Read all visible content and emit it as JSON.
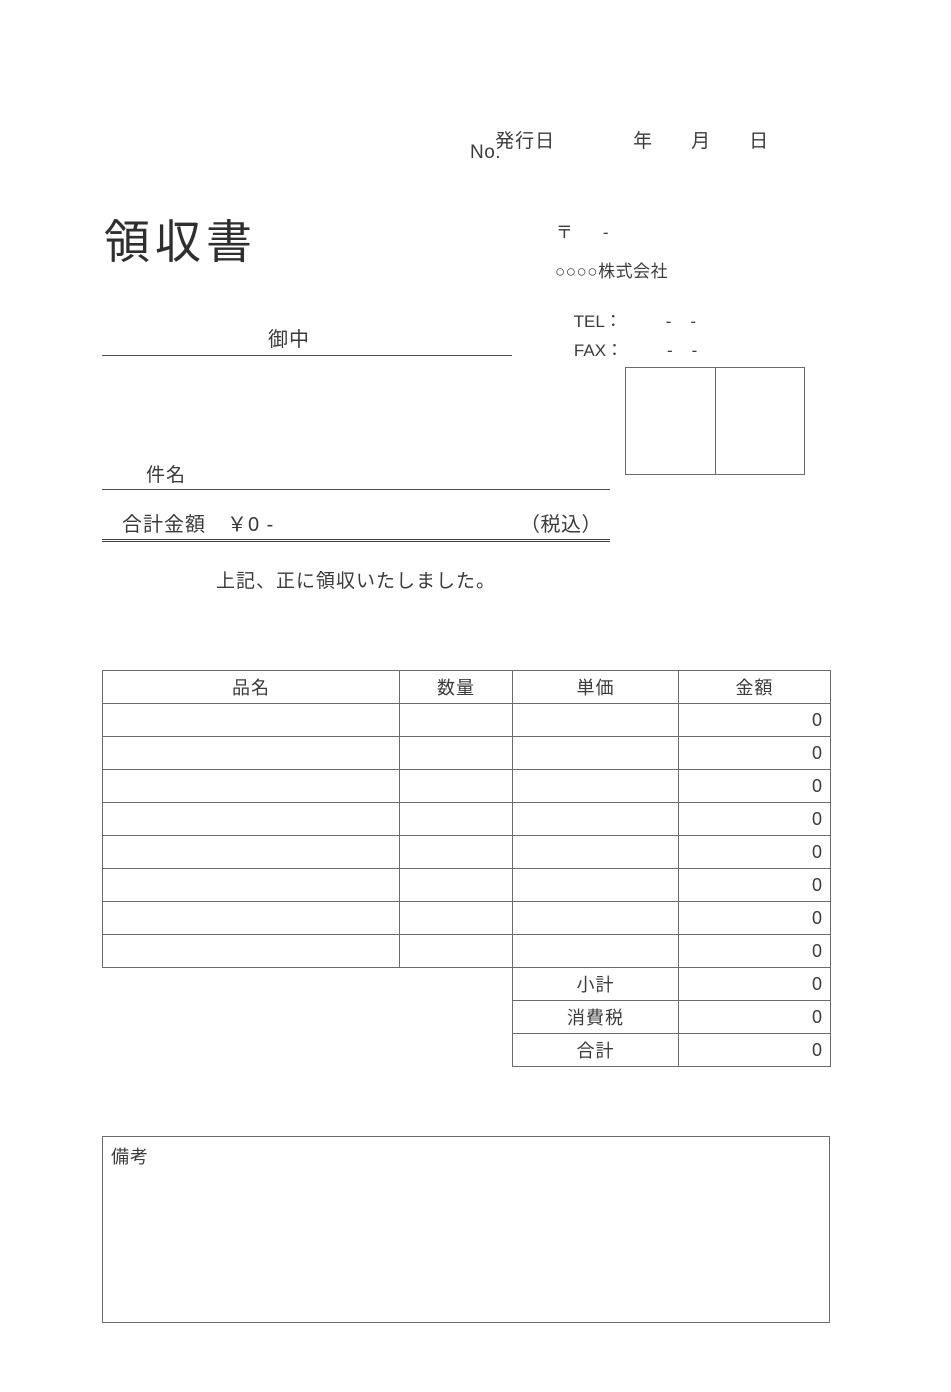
{
  "document": {
    "title": "領収書",
    "addressee_label": "御中",
    "subject_label": "件名",
    "receipt_note": "上記、正に領収いたしました。"
  },
  "header": {
    "issue_date_label": "発行日",
    "year_label": "年",
    "month_label": "月",
    "day_label": "日",
    "number_label": "No."
  },
  "issuer": {
    "postal_mark": "〒",
    "postal_separator": "-",
    "company_name": "○○○○株式会社",
    "tel_label": "TEL：",
    "tel_value": "-    -",
    "fax_label": "FAX：",
    "fax_value": "-    -"
  },
  "total": {
    "label": "合計金額",
    "amount": "￥0 -",
    "tax_note": "（税込）"
  },
  "items": {
    "headers": [
      "品名",
      "数量",
      "単価",
      "金額"
    ],
    "rows": [
      {
        "name": "",
        "qty": "",
        "price": "",
        "amount": "0"
      },
      {
        "name": "",
        "qty": "",
        "price": "",
        "amount": "0"
      },
      {
        "name": "",
        "qty": "",
        "price": "",
        "amount": "0"
      },
      {
        "name": "",
        "qty": "",
        "price": "",
        "amount": "0"
      },
      {
        "name": "",
        "qty": "",
        "price": "",
        "amount": "0"
      },
      {
        "name": "",
        "qty": "",
        "price": "",
        "amount": "0"
      },
      {
        "name": "",
        "qty": "",
        "price": "",
        "amount": "0"
      },
      {
        "name": "",
        "qty": "",
        "price": "",
        "amount": "0"
      }
    ],
    "summary": [
      {
        "label": "小計",
        "amount": "0"
      },
      {
        "label": "消費税",
        "amount": "0"
      },
      {
        "label": "合計",
        "amount": "0"
      }
    ]
  },
  "remarks": {
    "label": "備考",
    "value": ""
  },
  "colors": {
    "text": "#3b3b3b",
    "rule": "#4d4d4d",
    "table_border": "#6b6b6b",
    "background": "#ffffff"
  }
}
